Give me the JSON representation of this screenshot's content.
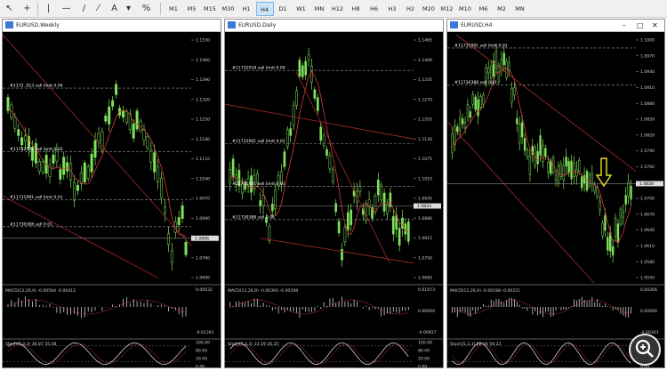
{
  "toolbar": {
    "timeframes": [
      "M1",
      "M5",
      "M15",
      "M30",
      "H1",
      "H4",
      "D1",
      "W1",
      "MN",
      "H12",
      "H8",
      "H6",
      "H3",
      "H2",
      "M20",
      "M12",
      "M10",
      "M6",
      "M2",
      "MN"
    ],
    "active_timeframe": "H4",
    "icons": [
      "cursor-icon",
      "crosshair-icon",
      "vertical-line-icon",
      "horizontal-line-icon",
      "trendline-icon",
      "channel-icon",
      "text-icon",
      "objects-icon"
    ]
  },
  "windows": [
    {
      "title": "EURUSD,Weekly",
      "price_scale": [
        "1.1530",
        "1.1460",
        "1.1390",
        "1.1320",
        "1.1250",
        "1.1180",
        "1.1110",
        "1.1040",
        "1.0970",
        "1.0900",
        "1.0830",
        "1.0760",
        "1.0690"
      ],
      "current_price": "1.0806",
      "order_lines": [
        {
          "label": "#1172..013 sell limit 0.04",
          "price": 1.136
        },
        {
          "label": "#11732001 sell limit 0.02",
          "price": 1.1135
        },
        {
          "label": "#11731991 sell limit 0.01",
          "price": 1.0965
        },
        {
          "label": "#11730388 sell 0.01",
          "price": 1.087
        }
      ],
      "macd_label": "MACD(12,26,9) -0.00594 -0.00412",
      "macd_scale": [
        "0.00032",
        "-0.01391"
      ],
      "stoch_label": "Stoch(5,3,3) 36.87 35.08",
      "stoch_scale": [
        "100.00",
        "80.00",
        "20.00",
        "0.00"
      ],
      "controls": []
    },
    {
      "title": "EURUSD,Daily",
      "price_scale": [
        "1.1465",
        "1.1400",
        "1.1335",
        "1.1270",
        "1.1205",
        "1.1140",
        "1.1075",
        "1.1010",
        "1.0945",
        "1.0880",
        "1.0815",
        "1.0750",
        "1.0685"
      ],
      "current_price": "1.0824",
      "order_lines": [
        {
          "label": "#11732018 sell limit 0.04",
          "price": 1.1365
        },
        {
          "label": "#11732001 sell limit 0.02",
          "price": 1.1125
        },
        {
          "label": "#11731991 sell limit 0.01",
          "price": 1.0985
        },
        {
          "label": "#11730388 sell 0.01",
          "price": 1.0875
        }
      ],
      "macd_label": "MACD(12,26,9) -0.00393 -0.00298",
      "macd_scale": [
        "0.01073",
        "0.00000",
        "-0.00937"
      ],
      "stoch_label": "Stoch(5,3,3) 33.19 26.25",
      "stoch_scale": [
        "100.00",
        "80.00",
        "20.00",
        "0.00"
      ],
      "controls": []
    },
    {
      "title": "EURUSD,H4",
      "price_scale": [
        "1.1000",
        "1.0970",
        "1.0940",
        "1.0910",
        "1.0880",
        "1.0850",
        "1.0820",
        "1.0790",
        "1.0760",
        "1.0730",
        "1.0700",
        "1.0670",
        "1.0640",
        "1.0610",
        "1.0580",
        "1.0550"
      ],
      "current_price": "1.0826",
      "order_lines": [
        {
          "label": "#11731991 sell limit 0.01",
          "price": 1.0985
        },
        {
          "label": "#11730388 sell 0.01",
          "price": 1.0915
        }
      ],
      "macd_label": "MACD(12,26,9) -0.00188 -0.00221",
      "macd_scale": [
        "0.00266",
        "0.00000",
        "-0.00301"
      ],
      "stoch_label": "Stoch(5,3,3) 82.04 59.23",
      "stoch_scale": [
        "100.00",
        "80.00",
        "20.00",
        "0.00"
      ],
      "controls": [
        "–",
        "□",
        "✕"
      ]
    }
  ]
}
